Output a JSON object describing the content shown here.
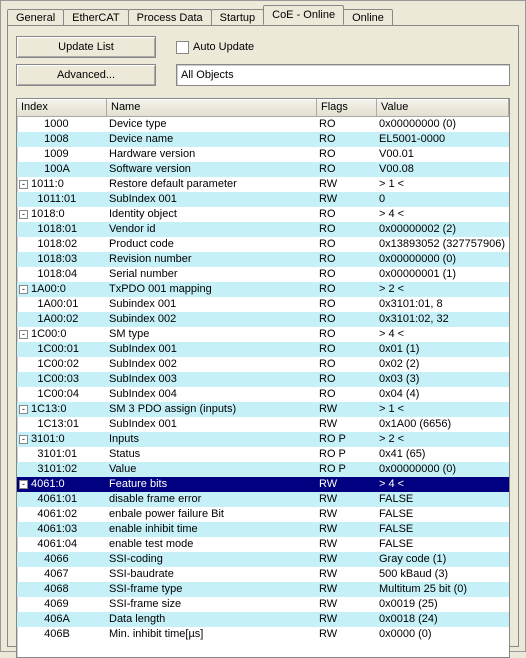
{
  "tabs": [
    "General",
    "EtherCAT",
    "Process Data",
    "Startup",
    "CoE - Online",
    "Online"
  ],
  "active_tab": 4,
  "buttons": {
    "update_list": "Update List",
    "advanced": "Advanced..."
  },
  "auto_update": {
    "label": "Auto Update",
    "checked": false
  },
  "filter_value": "All Objects",
  "columns": [
    "Index",
    "Name",
    "Flags",
    "Value"
  ],
  "rows": [
    {
      "type": "leaf",
      "indent": 0,
      "hl": false,
      "index": "1000",
      "name": "Device type",
      "flags": "RO",
      "value": "0x00000000 (0)"
    },
    {
      "type": "leaf",
      "indent": 0,
      "hl": true,
      "index": "1008",
      "name": "Device name",
      "flags": "RO",
      "value": "EL5001-0000"
    },
    {
      "type": "leaf",
      "indent": 0,
      "hl": false,
      "index": "1009",
      "name": "Hardware version",
      "flags": "RO",
      "value": "V00.01"
    },
    {
      "type": "leaf",
      "indent": 0,
      "hl": true,
      "index": "100A",
      "name": "Software version",
      "flags": "RO",
      "value": "V00.08"
    },
    {
      "type": "parent",
      "indent": 0,
      "hl": false,
      "index": "1011:0",
      "name": "Restore default parameter",
      "flags": "RW",
      "value": "> 1 <"
    },
    {
      "type": "sub",
      "indent": 1,
      "hl": true,
      "index": "1011:01",
      "name": "SubIndex 001",
      "flags": "RW",
      "value": "0"
    },
    {
      "type": "parent",
      "indent": 0,
      "hl": false,
      "index": "1018:0",
      "name": "Identity object",
      "flags": "RO",
      "value": "> 4 <"
    },
    {
      "type": "sub",
      "indent": 1,
      "hl": true,
      "index": "1018:01",
      "name": "Vendor id",
      "flags": "RO",
      "value": "0x00000002 (2)"
    },
    {
      "type": "sub",
      "indent": 1,
      "hl": false,
      "index": "1018:02",
      "name": "Product code",
      "flags": "RO",
      "value": "0x13893052 (327757906)"
    },
    {
      "type": "sub",
      "indent": 1,
      "hl": true,
      "index": "1018:03",
      "name": "Revision number",
      "flags": "RO",
      "value": "0x00000000 (0)"
    },
    {
      "type": "sub",
      "indent": 1,
      "hl": false,
      "index": "1018:04",
      "name": "Serial number",
      "flags": "RO",
      "value": "0x00000001 (1)"
    },
    {
      "type": "parent",
      "indent": 0,
      "hl": true,
      "index": "1A00:0",
      "name": "TxPDO 001 mapping",
      "flags": "RO",
      "value": "> 2 <"
    },
    {
      "type": "sub",
      "indent": 1,
      "hl": false,
      "index": "1A00:01",
      "name": "Subindex 001",
      "flags": "RO",
      "value": "0x3101:01, 8"
    },
    {
      "type": "sub",
      "indent": 1,
      "hl": true,
      "index": "1A00:02",
      "name": "Subindex 002",
      "flags": "RO",
      "value": "0x3101:02, 32"
    },
    {
      "type": "parent",
      "indent": 0,
      "hl": false,
      "index": "1C00:0",
      "name": "SM type",
      "flags": "RO",
      "value": "> 4 <"
    },
    {
      "type": "sub",
      "indent": 1,
      "hl": true,
      "index": "1C00:01",
      "name": "SubIndex 001",
      "flags": "RO",
      "value": "0x01 (1)"
    },
    {
      "type": "sub",
      "indent": 1,
      "hl": false,
      "index": "1C00:02",
      "name": "SubIndex 002",
      "flags": "RO",
      "value": "0x02 (2)"
    },
    {
      "type": "sub",
      "indent": 1,
      "hl": true,
      "index": "1C00:03",
      "name": "SubIndex 003",
      "flags": "RO",
      "value": "0x03 (3)"
    },
    {
      "type": "sub",
      "indent": 1,
      "hl": false,
      "index": "1C00:04",
      "name": "SubIndex 004",
      "flags": "RO",
      "value": "0x04 (4)"
    },
    {
      "type": "parent",
      "indent": 0,
      "hl": true,
      "index": "1C13:0",
      "name": "SM 3 PDO assign (inputs)",
      "flags": "RW",
      "value": "> 1 <"
    },
    {
      "type": "sub",
      "indent": 1,
      "hl": false,
      "index": "1C13:01",
      "name": "SubIndex 001",
      "flags": "RW",
      "value": "0x1A00 (6656)"
    },
    {
      "type": "parent",
      "indent": 0,
      "hl": true,
      "index": "3101:0",
      "name": "Inputs",
      "flags": "RO P",
      "value": "> 2 <"
    },
    {
      "type": "sub",
      "indent": 1,
      "hl": false,
      "index": "3101:01",
      "name": "Status",
      "flags": "RO P",
      "value": "0x41 (65)"
    },
    {
      "type": "sub",
      "indent": 1,
      "hl": true,
      "index": "3101:02",
      "name": "Value",
      "flags": "RO P",
      "value": "0x00000000 (0)"
    },
    {
      "type": "parent",
      "indent": 0,
      "sel": true,
      "index": "4061:0",
      "name": "Feature bits",
      "flags": "RW",
      "value": "> 4 <"
    },
    {
      "type": "sub",
      "indent": 1,
      "hl": true,
      "index": "4061:01",
      "name": "disable frame error",
      "flags": "RW",
      "value": "FALSE"
    },
    {
      "type": "sub",
      "indent": 1,
      "hl": false,
      "index": "4061:02",
      "name": "enbale power failure Bit",
      "flags": "RW",
      "value": "FALSE"
    },
    {
      "type": "sub",
      "indent": 1,
      "hl": true,
      "index": "4061:03",
      "name": "enable inhibit time",
      "flags": "RW",
      "value": "FALSE"
    },
    {
      "type": "sub",
      "indent": 1,
      "hl": false,
      "index": "4061:04",
      "name": "enable test mode",
      "flags": "RW",
      "value": "FALSE"
    },
    {
      "type": "leaf",
      "indent": 0,
      "hl": true,
      "index": "4066",
      "name": "SSI-coding",
      "flags": "RW",
      "value": "Gray code (1)"
    },
    {
      "type": "leaf",
      "indent": 0,
      "hl": false,
      "index": "4067",
      "name": "SSI-baudrate",
      "flags": "RW",
      "value": "500 kBaud (3)"
    },
    {
      "type": "leaf",
      "indent": 0,
      "hl": true,
      "index": "4068",
      "name": "SSI-frame type",
      "flags": "RW",
      "value": "Multitum 25 bit (0)"
    },
    {
      "type": "leaf",
      "indent": 0,
      "hl": false,
      "index": "4069",
      "name": "SSI-frame size",
      "flags": "RW",
      "value": "0x0019 (25)"
    },
    {
      "type": "leaf",
      "indent": 0,
      "hl": true,
      "index": "406A",
      "name": "Data length",
      "flags": "RW",
      "value": "0x0018 (24)"
    },
    {
      "type": "leaf",
      "indent": 0,
      "hl": false,
      "index": "406B",
      "name": "Min. inhibit time[µs]",
      "flags": "RW",
      "value": "0x0000 (0)"
    }
  ]
}
